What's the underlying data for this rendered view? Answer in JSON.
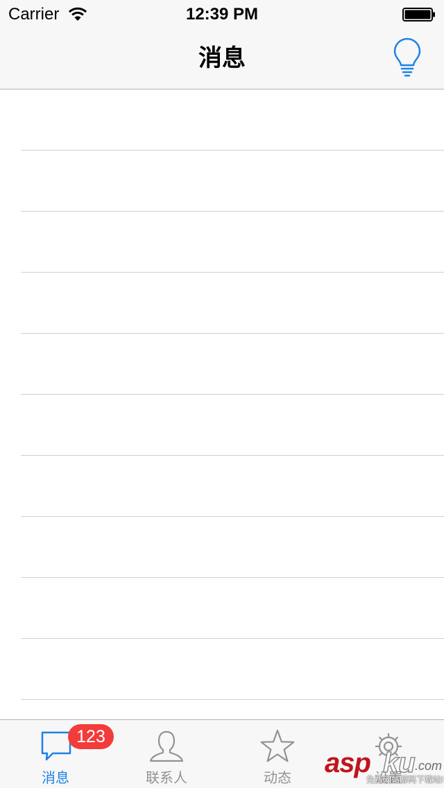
{
  "status_bar": {
    "carrier": "Carrier",
    "time": "12:39 PM",
    "wifi_icon": "wifi-icon",
    "battery_icon": "battery-icon"
  },
  "nav_bar": {
    "title": "消息",
    "right_button_icon": "lightbulb-icon"
  },
  "message_list": {
    "row_count": 10
  },
  "tab_bar": {
    "tabs": [
      {
        "label": "消息",
        "icon": "chat-bubble-icon",
        "active": true,
        "badge": "123"
      },
      {
        "label": "联系人",
        "icon": "person-icon",
        "active": false
      },
      {
        "label": "动态",
        "icon": "star-icon",
        "active": false
      },
      {
        "label": "设置",
        "icon": "gear-icon",
        "active": false
      }
    ]
  },
  "watermark": {
    "brand_a": "asp",
    "brand_b": "ku",
    "domain": ".com",
    "tagline": "免费网站源码下载站!"
  },
  "colors": {
    "accent": "#1a82e6",
    "badge": "#f23b3b",
    "inactive": "#929292",
    "bar_background": "#f7f7f7",
    "separator": "#d0d0d4"
  }
}
